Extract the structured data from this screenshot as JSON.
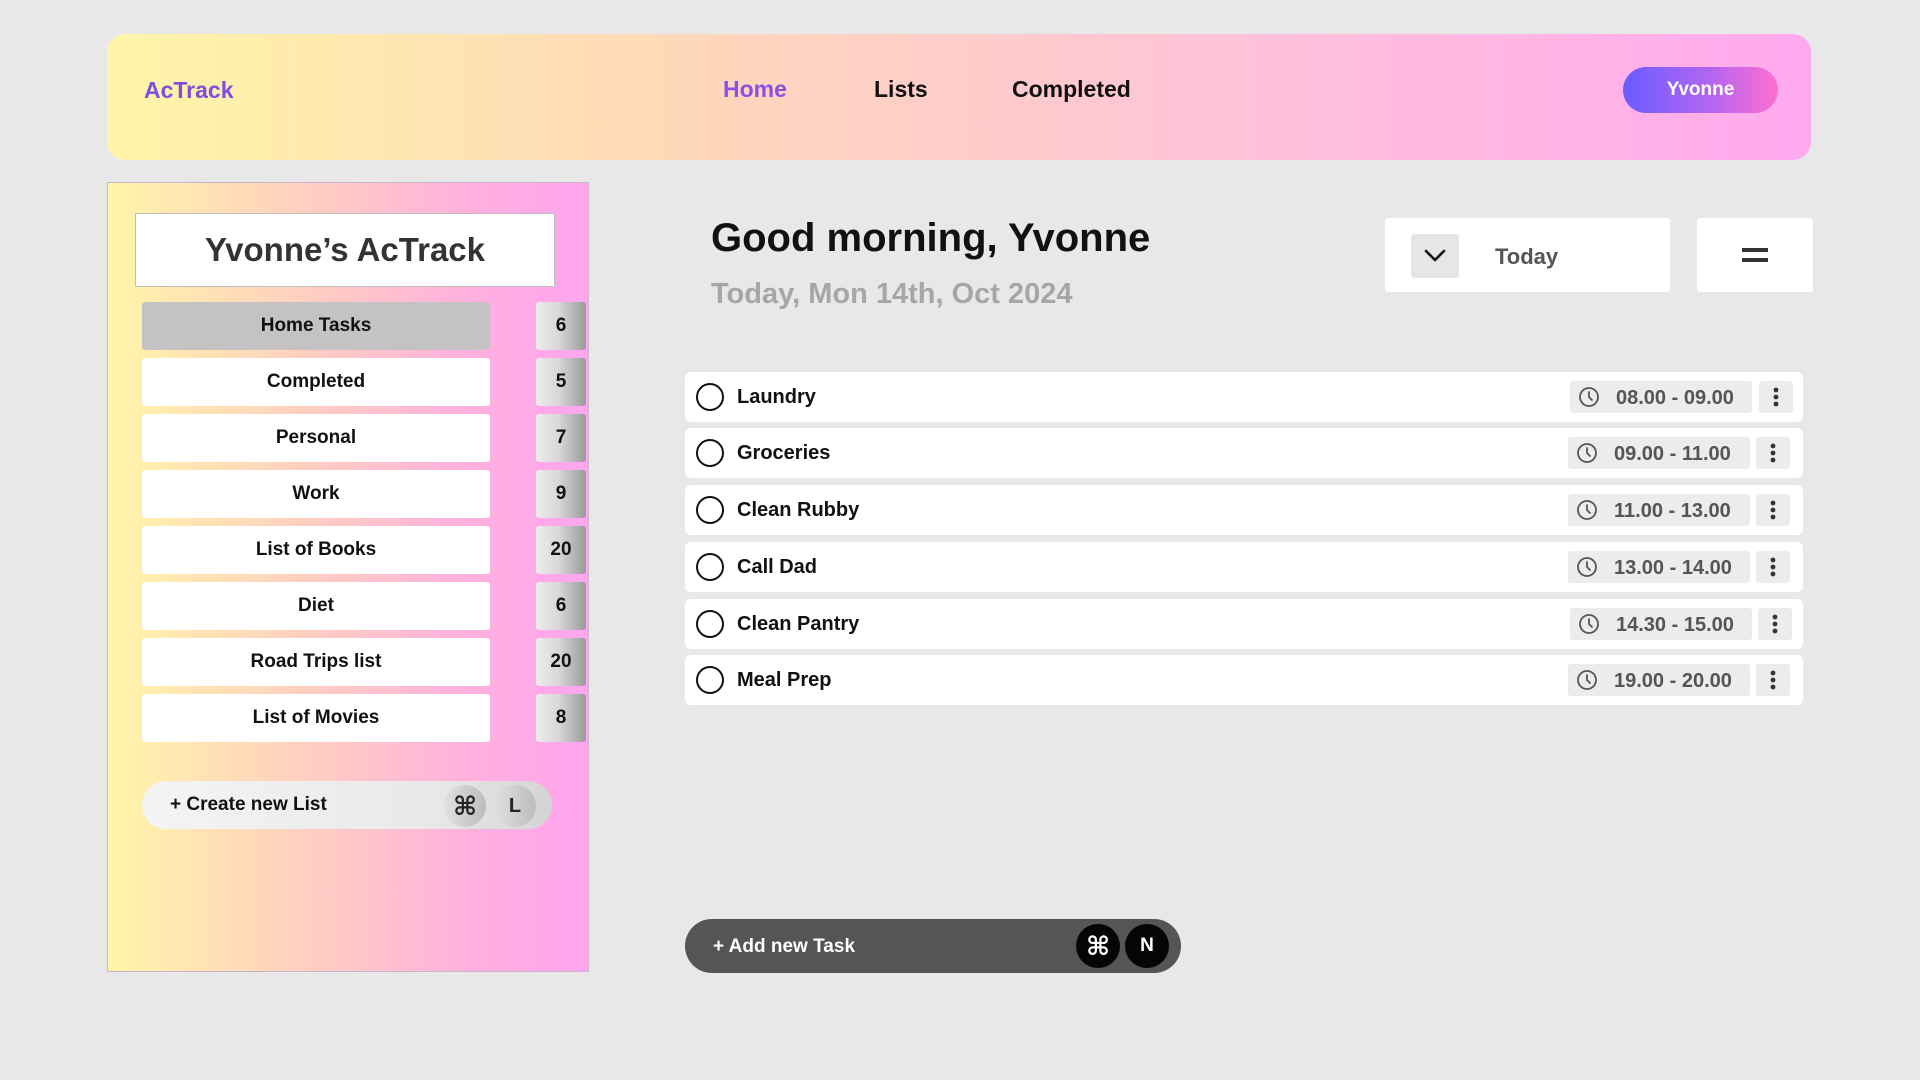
{
  "header": {
    "brand": "AcTrack",
    "nav": [
      {
        "label": "Home",
        "active": true
      },
      {
        "label": "Lists",
        "active": false
      },
      {
        "label": "Completed",
        "active": false
      }
    ],
    "user": "Yvonne"
  },
  "sidebar": {
    "title": "Yvonne’s AcTrack",
    "lists": [
      {
        "name": "Home Tasks",
        "count": "6",
        "selected": true
      },
      {
        "name": "Completed",
        "count": "5"
      },
      {
        "name": "Personal",
        "count": "7"
      },
      {
        "name": "Work",
        "count": "9"
      },
      {
        "name": "List of Books",
        "count": "20"
      },
      {
        "name": "Diet",
        "count": "6"
      },
      {
        "name": "Road Trips list",
        "count": "20"
      },
      {
        "name": "List of Movies",
        "count": "8"
      }
    ],
    "create_list": {
      "label": "+ Create new List",
      "shortcut_cmd": "⌘",
      "shortcut_key": "L"
    }
  },
  "main": {
    "greeting": "Good morning, Yvonne",
    "date": "Today, Mon 14th, Oct 2024",
    "date_filter": "Today",
    "tasks": [
      {
        "name": "Laundry",
        "time": "08.00 - 09.00"
      },
      {
        "name": "Groceries",
        "time": "09.00 - 11.00"
      },
      {
        "name": "Clean Rubby",
        "time": "11.00 - 13.00"
      },
      {
        "name": "Call Dad",
        "time": "13.00 - 14.00"
      },
      {
        "name": "Clean Pantry",
        "time": "14.30 - 15.00"
      },
      {
        "name": "Meal Prep",
        "time": "19.00 - 20.00"
      }
    ],
    "add_task": {
      "label": "+ Add  new Task",
      "shortcut_cmd": "⌘",
      "shortcut_key": "N"
    }
  },
  "colors": {
    "accent": "#8a4fe6",
    "background": "#e8e8e8",
    "add_task_bg": "#555555"
  },
  "icons": {
    "chevron": "chevron-down-icon",
    "menu": "menu-icon",
    "clock": "clock-icon",
    "more": "more-vertical-icon",
    "command": "command-icon"
  }
}
